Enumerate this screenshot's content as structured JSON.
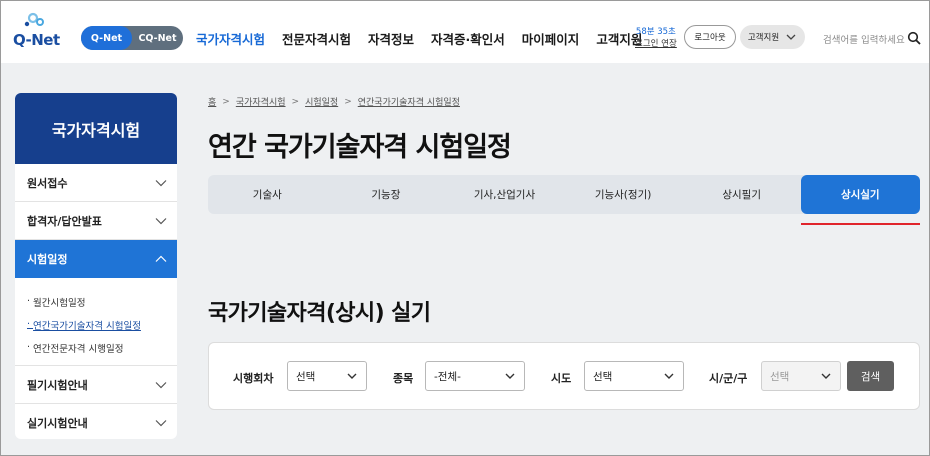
{
  "header": {
    "logo_text": "Q-Net",
    "site_toggle": [
      "Q-Net",
      "CQ-Net"
    ],
    "gnb": [
      "국가자격시험",
      "전문자격시험",
      "자격정보",
      "자격증·확인서",
      "마이페이지",
      "고객지원"
    ],
    "session_time": "58분 35초",
    "session_extend": "로그인 연장",
    "logout_label": "로그아웃",
    "cs_label": "고객지원",
    "search_placeholder": "검색어를 입력하세요"
  },
  "lnb": {
    "title": "국가자격시험",
    "items": [
      "원서접수",
      "합격자/답안발표",
      "시험일정"
    ],
    "sub_items": [
      "월간시험일정",
      "연간국가기술자격 시험일정",
      "연간전문자격 시행일정"
    ],
    "bottom_items": [
      "필기시험안내",
      "실기시험안내"
    ]
  },
  "breadcrumb": [
    "홈",
    "국가자격시험",
    "시험일정",
    "연간국가기술자격 시험일정"
  ],
  "page_title": "연간 국가기술자격 시험일정",
  "tabs": [
    "기술사",
    "기능장",
    "기사,산업기사",
    "기능사(정기)",
    "상시필기",
    "상시실기"
  ],
  "active_tab": "상시실기",
  "section_title": "국가기술자격(상시) 실기",
  "filter": {
    "round_label": "시행회차",
    "round_value": "선택",
    "category_label": "종목",
    "category_value": "-전체-",
    "province_label": "시도",
    "province_value": "선택",
    "city_label": "시/군/구",
    "city_value": "선택",
    "search_button": "검색"
  },
  "colors": {
    "brand_blue": "#1f74d6",
    "lnb_title_bg": "#163f8d",
    "active_underline": "#e0242c"
  }
}
